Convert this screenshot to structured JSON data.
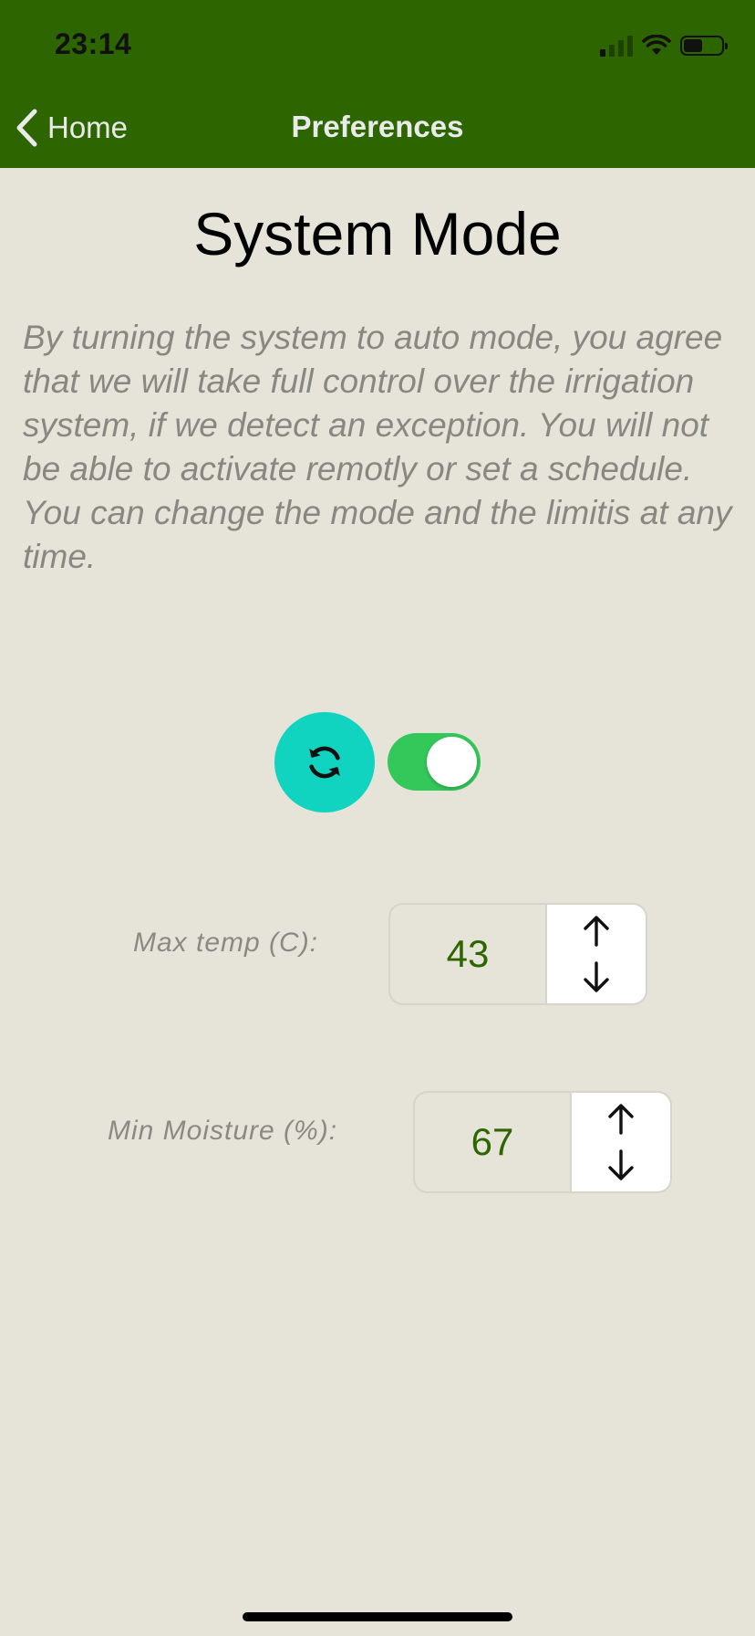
{
  "status_bar": {
    "time": "23:14",
    "signal_icon": "cellular-signal-icon",
    "wifi_icon": "wifi-icon",
    "battery_icon": "battery-icon",
    "battery_level": 0.5
  },
  "nav": {
    "back_label": "Home",
    "back_icon": "chevron-left-icon",
    "title": "Preferences"
  },
  "page": {
    "title": "System Mode",
    "description": "By turning the system to auto mode, you agree that we will take full control over the irrigation system, if we detect an exception. You will not be able to activate remotly or set a schedule. You can change the mode and the limitis at any time."
  },
  "mode": {
    "icon": "sync-icon",
    "toggle_on": true
  },
  "settings": {
    "max_temp": {
      "label": "Max temp (C):",
      "value": "43"
    },
    "min_moisture": {
      "label": "Min Moisture (%):",
      "value": "67"
    }
  },
  "colors": {
    "header": "#2d6600",
    "background": "#e6e4d9",
    "accent_teal": "#10d3c0",
    "toggle_on": "#34c759",
    "value_text": "#2d6600"
  }
}
